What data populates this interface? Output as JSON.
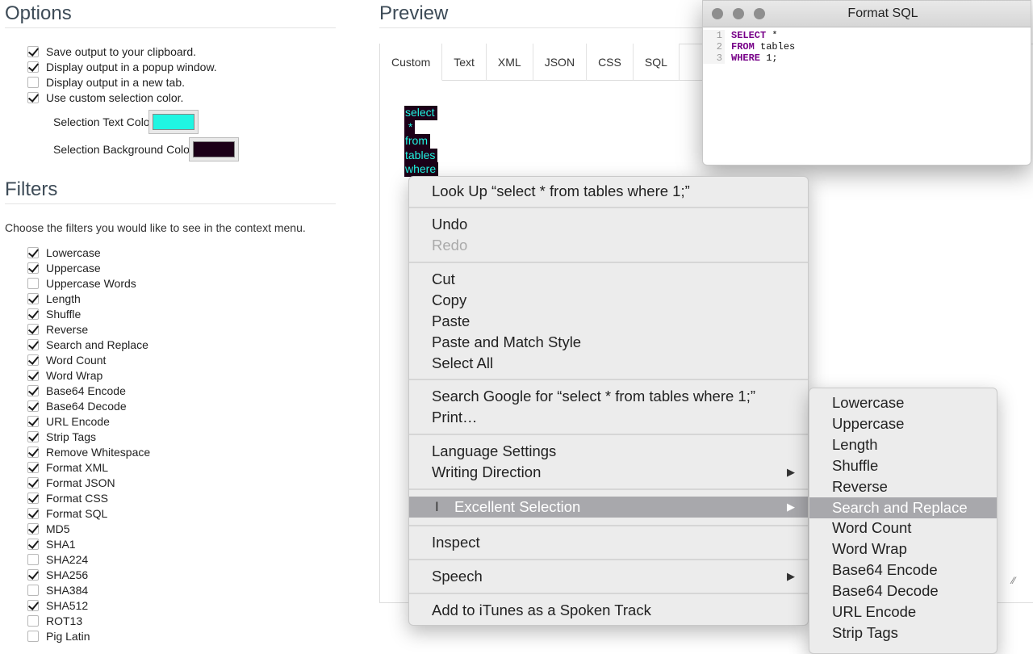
{
  "options": {
    "title": "Options",
    "checks": [
      {
        "label": "Save output to your clipboard.",
        "checked": true
      },
      {
        "label": "Display output in a popup window.",
        "checked": true
      },
      {
        "label": "Display output in a new tab.",
        "checked": false
      },
      {
        "label": "Use custom selection color.",
        "checked": true
      }
    ],
    "selection_text_color_label": "Selection Text Color",
    "selection_text_color": "#20f5e2",
    "selection_bg_color_label": "Selection Background Color",
    "selection_bg_color": "#1c0018"
  },
  "filters": {
    "title": "Filters",
    "description": "Choose the filters you would like to see in the context menu.",
    "items": [
      {
        "label": "Lowercase",
        "checked": true
      },
      {
        "label": "Uppercase",
        "checked": true
      },
      {
        "label": "Uppercase Words",
        "checked": false
      },
      {
        "label": "Length",
        "checked": true
      },
      {
        "label": "Shuffle",
        "checked": true
      },
      {
        "label": "Reverse",
        "checked": true
      },
      {
        "label": "Search and Replace",
        "checked": true
      },
      {
        "label": "Word Count",
        "checked": true
      },
      {
        "label": "Word Wrap",
        "checked": true
      },
      {
        "label": "Base64 Encode",
        "checked": true
      },
      {
        "label": "Base64 Decode",
        "checked": true
      },
      {
        "label": "URL Encode",
        "checked": true
      },
      {
        "label": "Strip Tags",
        "checked": true
      },
      {
        "label": "Remove Whitespace",
        "checked": true
      },
      {
        "label": "Format XML",
        "checked": true
      },
      {
        "label": "Format JSON",
        "checked": true
      },
      {
        "label": "Format CSS",
        "checked": true
      },
      {
        "label": "Format SQL",
        "checked": true
      },
      {
        "label": "MD5",
        "checked": true
      },
      {
        "label": "SHA1",
        "checked": true
      },
      {
        "label": "SHA224",
        "checked": false
      },
      {
        "label": "SHA256",
        "checked": true
      },
      {
        "label": "SHA384",
        "checked": false
      },
      {
        "label": "SHA512",
        "checked": true
      },
      {
        "label": "ROT13",
        "checked": false
      },
      {
        "label": "Pig Latin",
        "checked": false
      }
    ]
  },
  "preview": {
    "title": "Preview",
    "tabs": [
      "Custom",
      "Text",
      "XML",
      "JSON",
      "CSS",
      "SQL"
    ],
    "active_tab": "Custom",
    "selected_lines": [
      "select",
      " *",
      "from",
      "tables",
      "where"
    ]
  },
  "format_window": {
    "title": "Format SQL",
    "line_numbers": [
      "1",
      "2",
      "3"
    ],
    "lines": [
      {
        "kw": "SELECT",
        "rest": " *"
      },
      {
        "kw": "FROM",
        "rest": " tables"
      },
      {
        "kw": "WHERE",
        "rest": " 1;"
      }
    ]
  },
  "context_menu": {
    "look_up": "Look Up “select  * from tables where 1;”",
    "undo": "Undo",
    "redo": "Redo",
    "cut": "Cut",
    "copy": "Copy",
    "paste": "Paste",
    "paste_match": "Paste and Match Style",
    "select_all": "Select All",
    "search_google": "Search Google for “select  * from tables where 1;”",
    "print": "Print…",
    "language_settings": "Language Settings",
    "writing_direction": "Writing Direction",
    "excellent_selection": "Excellent Selection",
    "inspect": "Inspect",
    "speech": "Speech",
    "itunes": "Add to iTunes as a Spoken Track",
    "arrow": "▶"
  },
  "submenu": {
    "items": [
      "Lowercase",
      "Uppercase",
      "Length",
      "Shuffle",
      "Reverse",
      "Search and Replace",
      "Word Count",
      "Word Wrap",
      "Base64 Encode",
      "Base64 Decode",
      "URL Encode",
      "Strip Tags"
    ],
    "highlighted": "Search and Replace"
  }
}
